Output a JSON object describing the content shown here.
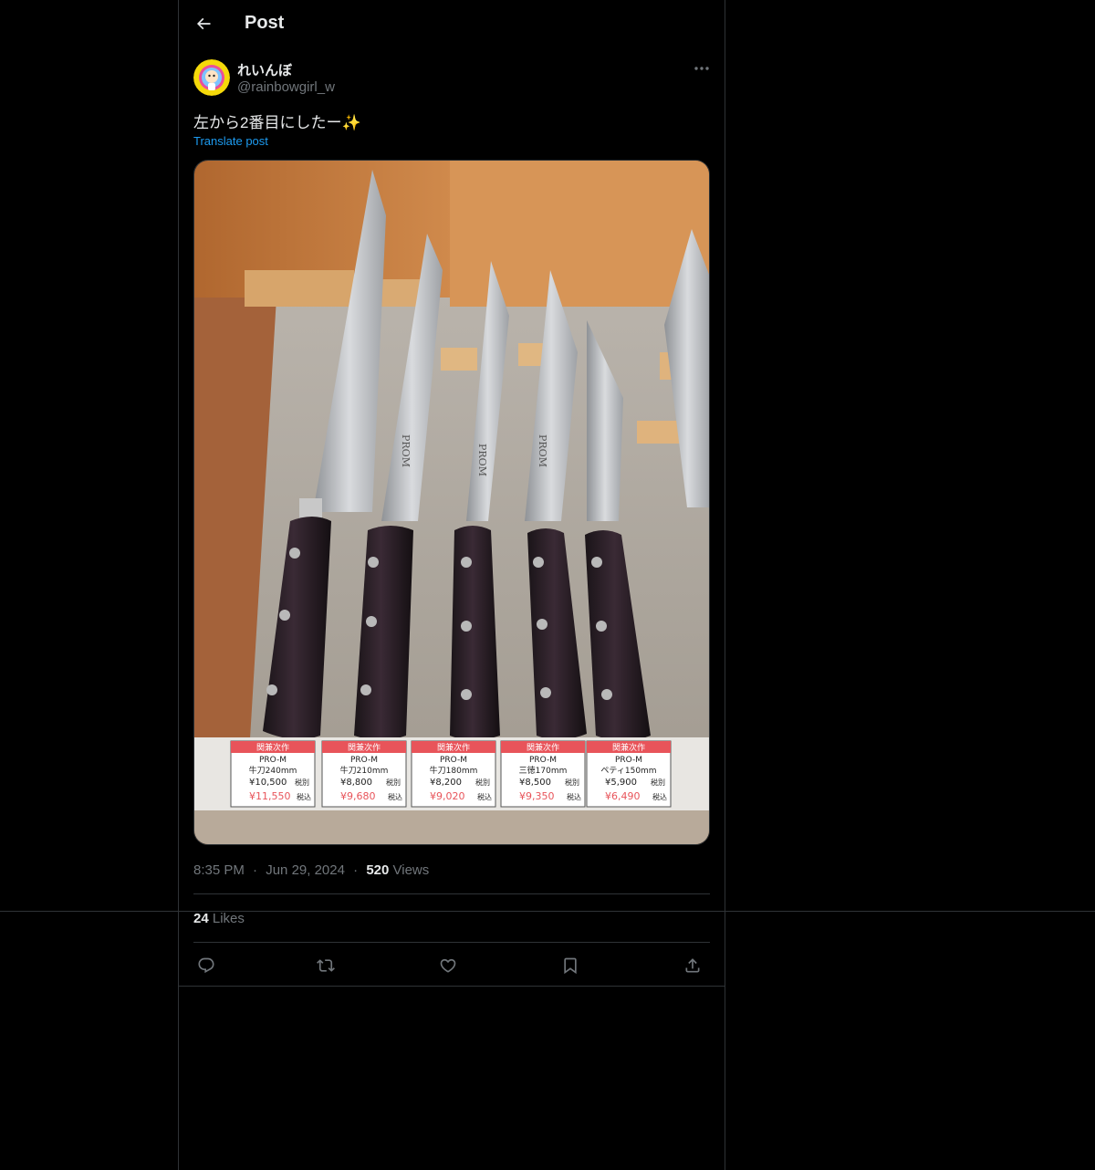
{
  "header": {
    "title": "Post",
    "back_icon": "arrow-left-icon"
  },
  "post": {
    "author": {
      "display_name": "れいんぼ",
      "handle": "@rainbowgirl_w"
    },
    "text": "左から2番目にしたー✨",
    "translate_label": "Translate post",
    "media": {
      "price_tags": [
        {
          "maker": "関兼次作",
          "model": "PRO-M",
          "name": "牛刀240mm",
          "price_ex": "¥10,500",
          "ex_label": "税別",
          "price_in": "¥11,550",
          "in_label": "税込"
        },
        {
          "maker": "関兼次作",
          "model": "PRO-M",
          "name": "牛刀210mm",
          "price_ex": "¥8,800",
          "ex_label": "税別",
          "price_in": "¥9,680",
          "in_label": "税込"
        },
        {
          "maker": "関兼次作",
          "model": "PRO-M",
          "name": "牛刀180mm",
          "price_ex": "¥8,200",
          "ex_label": "税別",
          "price_in": "¥9,020",
          "in_label": "税込"
        },
        {
          "maker": "関兼次作",
          "model": "PRO-M",
          "name": "三徳170mm",
          "price_ex": "¥8,500",
          "ex_label": "税別",
          "price_in": "¥9,350",
          "in_label": "税込"
        },
        {
          "maker": "関兼次作",
          "model": "PRO-M",
          "name": "ペティ150mm",
          "price_ex": "¥5,900",
          "ex_label": "税別",
          "price_in": "¥6,490",
          "in_label": "税込"
        }
      ],
      "blade_mark": "PROM"
    },
    "time": "8:35 PM",
    "dot": "·",
    "date": "Jun 29, 2024",
    "views_count": "520",
    "views_label": "Views",
    "likes_count": "24",
    "likes_label": "Likes"
  },
  "actions": {
    "reply_icon": "reply-icon",
    "repost_icon": "repost-icon",
    "like_icon": "heart-icon",
    "bookmark_icon": "bookmark-icon",
    "share_icon": "share-icon"
  },
  "colors": {
    "background": "#000000",
    "text": "#e7e9ea",
    "muted": "#71767b",
    "link": "#1d9bf0",
    "border": "#2f3336"
  }
}
